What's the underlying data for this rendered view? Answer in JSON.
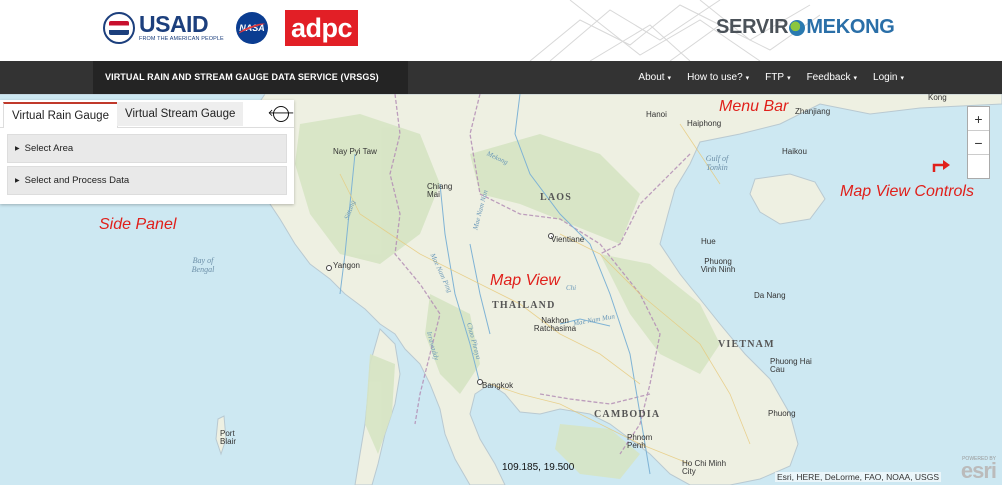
{
  "header": {
    "usaid_word": "USAID",
    "usaid_tagline": "FROM THE AMERICAN PEOPLE",
    "nasa_word": "NASA",
    "adpc_word": "adpc",
    "servir_word": "SERVIR",
    "mekong_word": "MEKONG"
  },
  "nav": {
    "title": "VIRTUAL RAIN AND STREAM GAUGE DATA SERVICE (VRSGS)",
    "items": [
      "About",
      "How to use?",
      "FTP",
      "Feedback",
      "Login"
    ]
  },
  "panel": {
    "tabs": [
      "Virtual Rain Gauge",
      "Virtual Stream Gauge"
    ],
    "active_tab": "Virtual Rain Gauge",
    "sections": [
      "Select Area",
      "Select and Process Data"
    ]
  },
  "map": {
    "countries": [
      "LAOS",
      "THAILAND",
      "VIETNAM",
      "CAMBODIA"
    ],
    "cities": [
      "Nay Pyi Taw",
      "Chiang Mai",
      "Hanoi",
      "Haiphong",
      "Vientiane",
      "Yangon",
      "Nakhon Ratchasima",
      "Bangkok",
      "Hue",
      "Phuong Vinh Ninh",
      "Da Nang",
      "Phuong Hai Cau",
      "Phnom Penh",
      "Ho Chi Minh City",
      "Port Blair",
      "Phuong",
      "Haikou",
      "Zhanjiang",
      "Kong"
    ],
    "water_labels": [
      "Bay of Bengal",
      "Gulf of Tonkin"
    ],
    "rivers": [
      "Mekong",
      "Sittang",
      "Mae Nam Ping",
      "Mae Nam Nan",
      "Chao Phraya",
      "Mae Nam Mun",
      "Chi",
      "Irrawaddy"
    ],
    "coordinates": "109.185, 19.500",
    "attribution": "Esri, HERE, DeLorme, FAO, NOAA, USGS",
    "esri_powered": "POWERED BY",
    "esri_word": "esri"
  },
  "zoom": {
    "in_label": "+",
    "out_label": "−"
  },
  "annotations": {
    "menu_bar": "Menu Bar",
    "side_panel": "Side Panel",
    "map_view": "Map View",
    "map_view_controls": "Map View Controls"
  },
  "colors": {
    "navbar": "#333333",
    "nav_title_bg": "#242424",
    "annotation": "#e0201b",
    "sea": "#cde8f2",
    "land": "#eef0e2"
  }
}
